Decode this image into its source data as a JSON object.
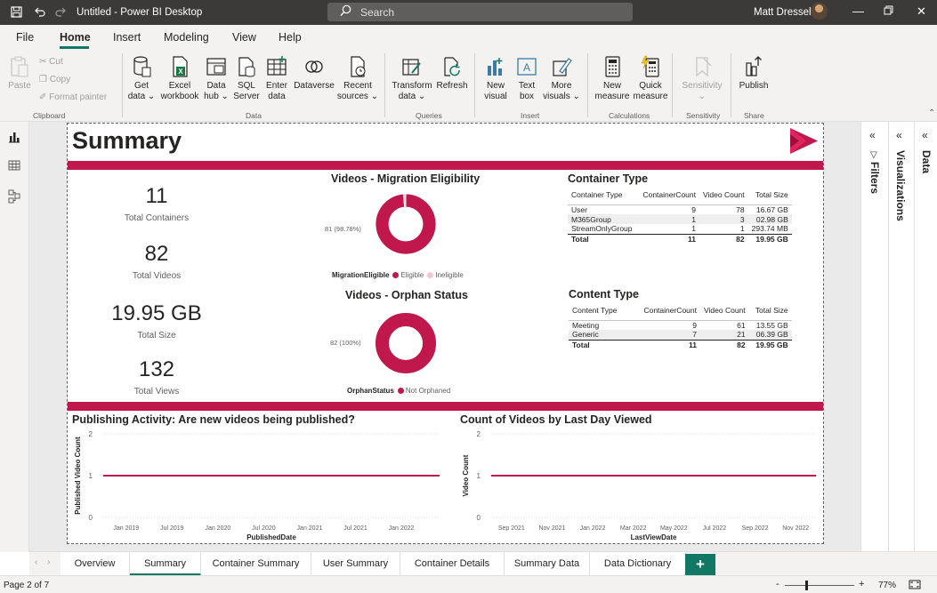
{
  "app": {
    "title": "Untitled - Power BI Desktop",
    "search_placeholder": "Search",
    "user_name": "Matt Dressel"
  },
  "menu": [
    {
      "label": "File"
    },
    {
      "label": "Home"
    },
    {
      "label": "Insert"
    },
    {
      "label": "Modeling"
    },
    {
      "label": "View"
    },
    {
      "label": "Help"
    }
  ],
  "ribbon": {
    "clipboard": {
      "paste": "Paste",
      "cut": "Cut",
      "copy": "Copy",
      "format_painter": "Format painter",
      "group": "Clipboard"
    },
    "data": {
      "get_data": [
        "Get",
        "data ⌄"
      ],
      "excel": [
        "Excel",
        "workbook"
      ],
      "data_hub": [
        "Data",
        "hub ⌄"
      ],
      "sql": [
        "SQL",
        "Server"
      ],
      "enter": [
        "Enter",
        "data"
      ],
      "dataverse": [
        "Dataverse",
        ""
      ],
      "recent": [
        "Recent",
        "sources ⌄"
      ],
      "group": "Data"
    },
    "queries": {
      "transform": [
        "Transform",
        "data ⌄"
      ],
      "refresh": [
        "Refresh",
        ""
      ],
      "group": "Queries"
    },
    "insert": {
      "new_visual": [
        "New",
        "visual"
      ],
      "text_box": [
        "Text",
        "box"
      ],
      "more_visuals": [
        "More",
        "visuals ⌄"
      ],
      "group": "Insert"
    },
    "calculations": {
      "new_measure": [
        "New",
        "measure"
      ],
      "quick_measure": [
        "Quick",
        "measure"
      ],
      "group": "Calculations"
    },
    "sensitivity": {
      "label": [
        "Sensitivity",
        "⌄"
      ],
      "group": "Sensitivity"
    },
    "share": {
      "publish": [
        "Publish",
        ""
      ],
      "group": "Share"
    }
  },
  "colors": {
    "accent": "#c0174d",
    "ineligible": "#f4c6d4",
    "teal": "#117865"
  },
  "report": {
    "title": "Summary",
    "cards": [
      {
        "value": "11",
        "label": "Total Containers"
      },
      {
        "value": "82",
        "label": "Total Videos"
      },
      {
        "value": "19.95 GB",
        "label": "Total Size"
      },
      {
        "value": "132",
        "label": "Total Views"
      }
    ],
    "migration": {
      "title": "Videos - Migration Eligibility",
      "note": "81 (98.78%)",
      "legend_title": "MigrationEligible",
      "legend": [
        "Eligible",
        "Ineligible"
      ],
      "slices": [
        {
          "name": "Eligible",
          "value": 81
        },
        {
          "name": "Ineligible",
          "value": 1
        }
      ]
    },
    "orphan": {
      "title": "Videos - Orphan Status",
      "note": "82 (100%)",
      "legend_title": "OrphanStatus",
      "legend": [
        "Not Orphaned"
      ],
      "slices": [
        {
          "name": "Not Orphaned",
          "value": 82
        }
      ]
    },
    "container_type": {
      "title": "Container Type",
      "columns": [
        "Container Type",
        "ContainerCount",
        "Video Count",
        "Total Size"
      ],
      "rows": [
        [
          "User",
          "9",
          "78",
          "16.67 GB"
        ],
        [
          "M365Group",
          "1",
          "3",
          "02.98 GB"
        ],
        [
          "StreamOnlyGroup",
          "1",
          "1",
          "293.74 MB"
        ]
      ],
      "total": [
        "Total",
        "11",
        "82",
        "19.95 GB"
      ]
    },
    "content_type": {
      "title": "Content Type",
      "columns": [
        "Content Type",
        "ContainerCount",
        "Video Count",
        "Total Size"
      ],
      "rows": [
        [
          "Meeting",
          "9",
          "61",
          "13.55 GB"
        ],
        [
          "Generic",
          "7",
          "21",
          "06.39 GB"
        ]
      ],
      "total": [
        "Total",
        "11",
        "82",
        "19.95 GB"
      ]
    }
  },
  "chart_data": [
    {
      "type": "line",
      "title": "Publishing Activity: Are new videos being published?",
      "xlabel": "PublishedDate",
      "ylabel": "Published Video Count",
      "ylim": [
        0,
        2
      ],
      "yticks": [
        "0",
        "1",
        "2"
      ],
      "xticks": [
        "Jan 2019",
        "Jul 2019",
        "Jan 2020",
        "Jul 2020",
        "Jan 2021",
        "Jul 2021",
        "Jan 2022"
      ],
      "series": [
        {
          "x": [
            "2018-10",
            "2022-06"
          ],
          "y": [
            1,
            1
          ]
        }
      ],
      "grid": true
    },
    {
      "type": "line",
      "title": "Count of Videos by Last Day Viewed",
      "xlabel": "LastViewDate",
      "ylabel": "Video Count",
      "ylim": [
        0,
        2
      ],
      "yticks": [
        "0",
        "1",
        "2"
      ],
      "xticks": [
        "Sep 2021",
        "Nov 2021",
        "Jan 2022",
        "Mar 2022",
        "May 2022",
        "Jul 2022",
        "Sep 2022",
        "Nov 2022"
      ],
      "series": [
        {
          "x": [
            "2021-08",
            "2022-12"
          ],
          "y": [
            1,
            1
          ]
        }
      ],
      "grid": true
    }
  ],
  "panes": {
    "filters": "Filters",
    "visualizations": "Visualizations",
    "data": "Data"
  },
  "tabs": [
    "Overview",
    "Summary",
    "Container Summary",
    "User Summary",
    "Container Details",
    "Summary Data",
    "Data Dictionary"
  ],
  "active_tab": "Summary",
  "add_tab": "+",
  "status": {
    "page": "Page 2 of 7",
    "zoom": "77%"
  }
}
